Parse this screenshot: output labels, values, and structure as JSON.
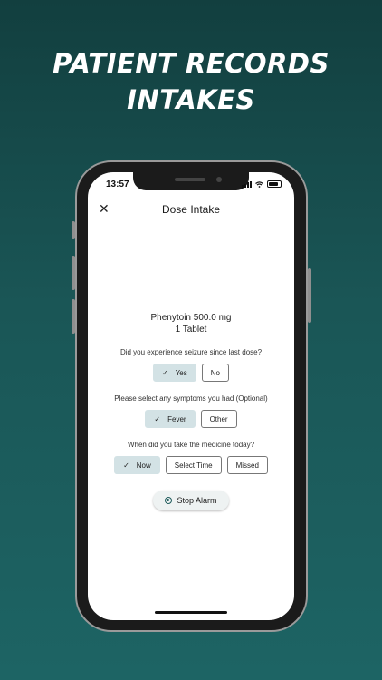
{
  "headline": {
    "line1": "PATIENT RECORDS",
    "line2": "INTAKES"
  },
  "status_bar": {
    "time": "13:57"
  },
  "header": {
    "title": "Dose Intake",
    "close_icon": "close-icon"
  },
  "medicine": {
    "name": "Phenytoin 500.0 mg",
    "quantity": "1 Tablet"
  },
  "seizure_question": {
    "label": "Did you experience seizure since last dose?",
    "options": [
      {
        "label": "Yes",
        "selected": true
      },
      {
        "label": "No",
        "selected": false
      }
    ]
  },
  "symptoms_question": {
    "label": "Please select any symptoms you had (Optional)",
    "options": [
      {
        "label": "Fever",
        "selected": true
      },
      {
        "label": "Other",
        "selected": false
      }
    ]
  },
  "time_question": {
    "label": "When did you take the medicine today?",
    "options": [
      {
        "label": "Now",
        "selected": true
      },
      {
        "label": "Select Time",
        "selected": false
      },
      {
        "label": "Missed",
        "selected": false
      }
    ]
  },
  "stop_alarm": {
    "label": "Stop Alarm",
    "icon": "radio-icon"
  },
  "colors": {
    "accent": "#1f5b5b",
    "chip_selected": "#d3e2e5",
    "background": "#1a5656"
  }
}
